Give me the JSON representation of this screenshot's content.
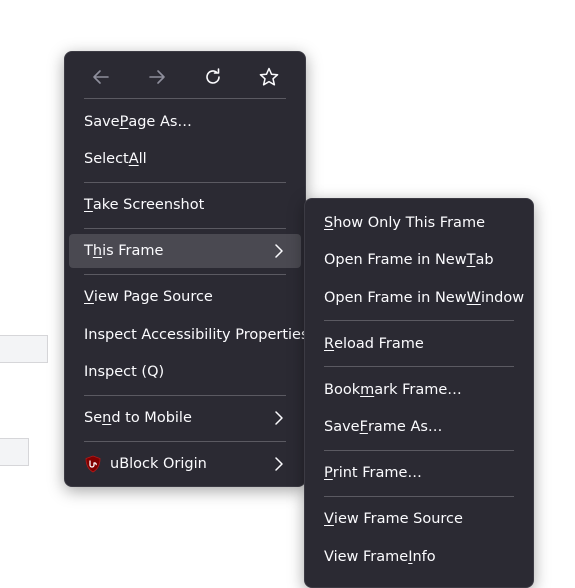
{
  "main_menu": {
    "nav": {
      "back": "back-arrow-icon",
      "forward": "forward-arrow-icon",
      "reload": "reload-icon",
      "bookmark": "star-icon"
    },
    "items": {
      "save_page_as": {
        "pre": "Save ",
        "key": "P",
        "post": "age As…"
      },
      "select_all": {
        "pre": "Select ",
        "key": "A",
        "post": "ll"
      },
      "take_screenshot": {
        "pre": "",
        "key": "T",
        "post": "ake Screenshot"
      },
      "this_frame": {
        "pre": "T",
        "key": "h",
        "post": "is Frame"
      },
      "view_page_source": {
        "pre": "",
        "key": "V",
        "post": "iew Page Source"
      },
      "inspect_accessibility": {
        "label": "Inspect Accessibility Properties"
      },
      "inspect": {
        "label": "Inspect (Q)"
      },
      "send_to_mobile": {
        "pre": "Se",
        "key": "n",
        "post": "d to Mobile"
      },
      "ublock": {
        "label": "uBlock Origin"
      }
    }
  },
  "sub_menu": {
    "items": {
      "show_only": {
        "pre": "",
        "key": "S",
        "post": "how Only This Frame"
      },
      "open_new_tab": {
        "pre": "Open Frame in New ",
        "key": "T",
        "post": "ab"
      },
      "open_new_window": {
        "pre": "Open Frame in New ",
        "key": "W",
        "post": "indow"
      },
      "reload_frame": {
        "pre": "",
        "key": "R",
        "post": "eload Frame"
      },
      "bookmark_frame": {
        "pre": "Book",
        "key": "m",
        "post": "ark Frame…"
      },
      "save_frame_as": {
        "pre": "Save ",
        "key": "F",
        "post": "rame As…"
      },
      "print_frame": {
        "pre": "",
        "key": "P",
        "post": "rint Frame…"
      },
      "view_frame_source": {
        "pre": "",
        "key": "V",
        "post": "iew Frame Source"
      },
      "view_frame_info": {
        "pre": "View Frame ",
        "key": "I",
        "post": "nfo"
      }
    }
  },
  "colors": {
    "menu_bg": "#2b2a33",
    "menu_text": "#fbfbfe",
    "hover_bg": "#4a4951",
    "separator": "#5b5a62",
    "ublock_red": "#800000"
  }
}
